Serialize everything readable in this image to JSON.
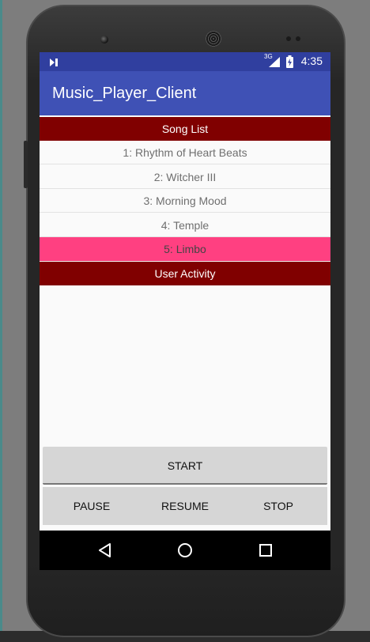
{
  "status_bar": {
    "time": "4:35",
    "network_label": "3G",
    "icons": [
      "media-notification-icon",
      "signal-icon",
      "battery-icon"
    ]
  },
  "app_bar": {
    "title": "Music_Player_Client"
  },
  "song_list": {
    "header": "Song List",
    "items": [
      {
        "label": "1: Rhythm of Heart Beats",
        "selected": false
      },
      {
        "label": "2: Witcher III",
        "selected": false
      },
      {
        "label": "3: Morning Mood",
        "selected": false
      },
      {
        "label": "4: Temple",
        "selected": false
      },
      {
        "label": "5: Limbo",
        "selected": true
      }
    ]
  },
  "user_activity": {
    "header": "User Activity"
  },
  "controls": {
    "start_label": "START",
    "pause_label": "PAUSE",
    "resume_label": "RESUME",
    "stop_label": "STOP"
  },
  "nav_bar": {
    "icons": [
      "back-icon",
      "home-icon",
      "recents-icon"
    ]
  },
  "colors": {
    "status_bar": "#303f9f",
    "app_bar": "#3f51b5",
    "section_header": "#800000",
    "selected_item": "#ff4081",
    "button": "#d6d6d6"
  }
}
